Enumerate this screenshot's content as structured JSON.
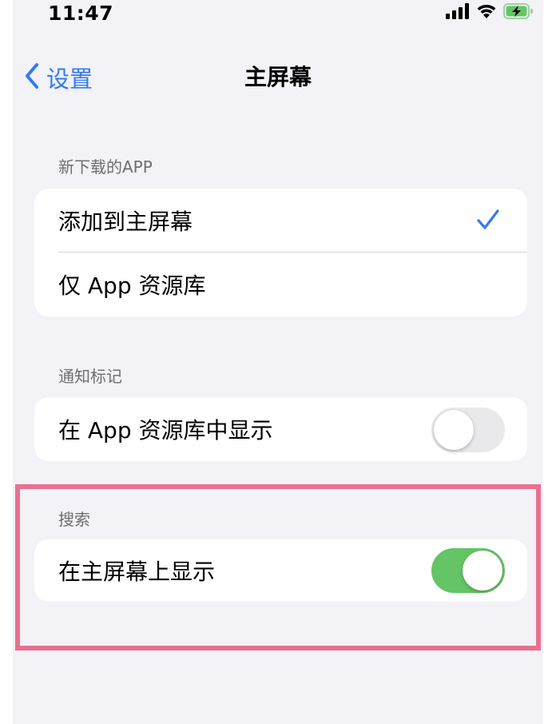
{
  "status_bar": {
    "time": "11:47"
  },
  "nav": {
    "back_label": "设置",
    "title": "主屏幕"
  },
  "sections": {
    "new_downloads": {
      "header": "新下载的APP",
      "options": [
        {
          "label": "添加到主屏幕",
          "selected": true
        },
        {
          "label": "仅 App 资源库",
          "selected": false
        }
      ]
    },
    "notification_badges": {
      "header": "通知标记",
      "rows": [
        {
          "label": "在 App 资源库中显示",
          "toggle": "off"
        }
      ]
    },
    "search": {
      "header": "搜索",
      "rows": [
        {
          "label": "在主屏幕上显示",
          "toggle": "on"
        }
      ]
    }
  },
  "colors": {
    "accent": "#3478f6",
    "toggle_on": "#65c466",
    "toggle_off": "#e9e9eb",
    "background": "#f2f2f7",
    "highlight": "#e9718f"
  },
  "icons": {
    "back": "chevron-left-icon",
    "check": "checkmark-icon",
    "signal": "cellular-signal-icon",
    "wifi": "wifi-icon",
    "battery": "battery-charging-icon"
  }
}
